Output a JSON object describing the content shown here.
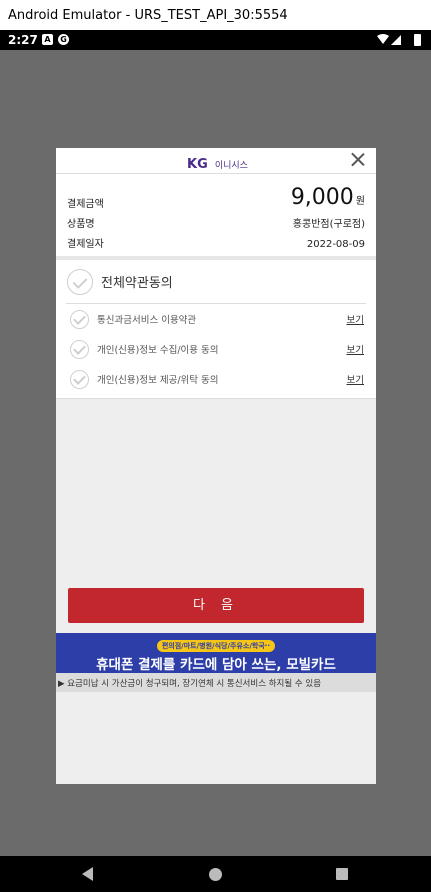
{
  "window": {
    "title": "Android Emulator - URS_TEST_API_30:5554"
  },
  "status_bar": {
    "time": "2:27",
    "icon_a": "A",
    "icon_b": "G"
  },
  "dialog": {
    "logo_kg": "KG",
    "logo_name": "이니시스",
    "summary": {
      "amount_label": "결제금액",
      "amount_value": "9,000",
      "amount_unit": "원",
      "product_label": "상품명",
      "product_value": "홍콩반점(구로점)",
      "date_label": "결제일자",
      "date_value": "2022-08-09"
    },
    "terms": {
      "agree_all": "전체약관동의",
      "items": [
        {
          "label": "통신과금서비스 이용약관",
          "view": "보기"
        },
        {
          "label": "개인(신용)정보 수집/이용 동의",
          "view": "보기"
        },
        {
          "label": "개인(신용)정보 제공/위탁 동의",
          "view": "보기"
        }
      ]
    },
    "next_button": "다 음",
    "banner": {
      "tag": "편의점/마트/병원/식당/주유소/학국··",
      "title": "휴대폰 결제를 카드에 담아 쓰는, 모빌카드"
    },
    "notice": "▶ 요금미납 시 가산금이 청구되며, 장기연체 시 통신서비스 하지될 수 있음"
  },
  "colors": {
    "accent": "#c1272d",
    "banner": "#2d3ea8",
    "brand": "#4b2a8a"
  },
  "icons": {
    "close": "close-icon",
    "check": "check-circle-icon",
    "nav_back": "back-icon",
    "nav_home": "home-icon",
    "nav_recent": "recent-apps-icon"
  }
}
